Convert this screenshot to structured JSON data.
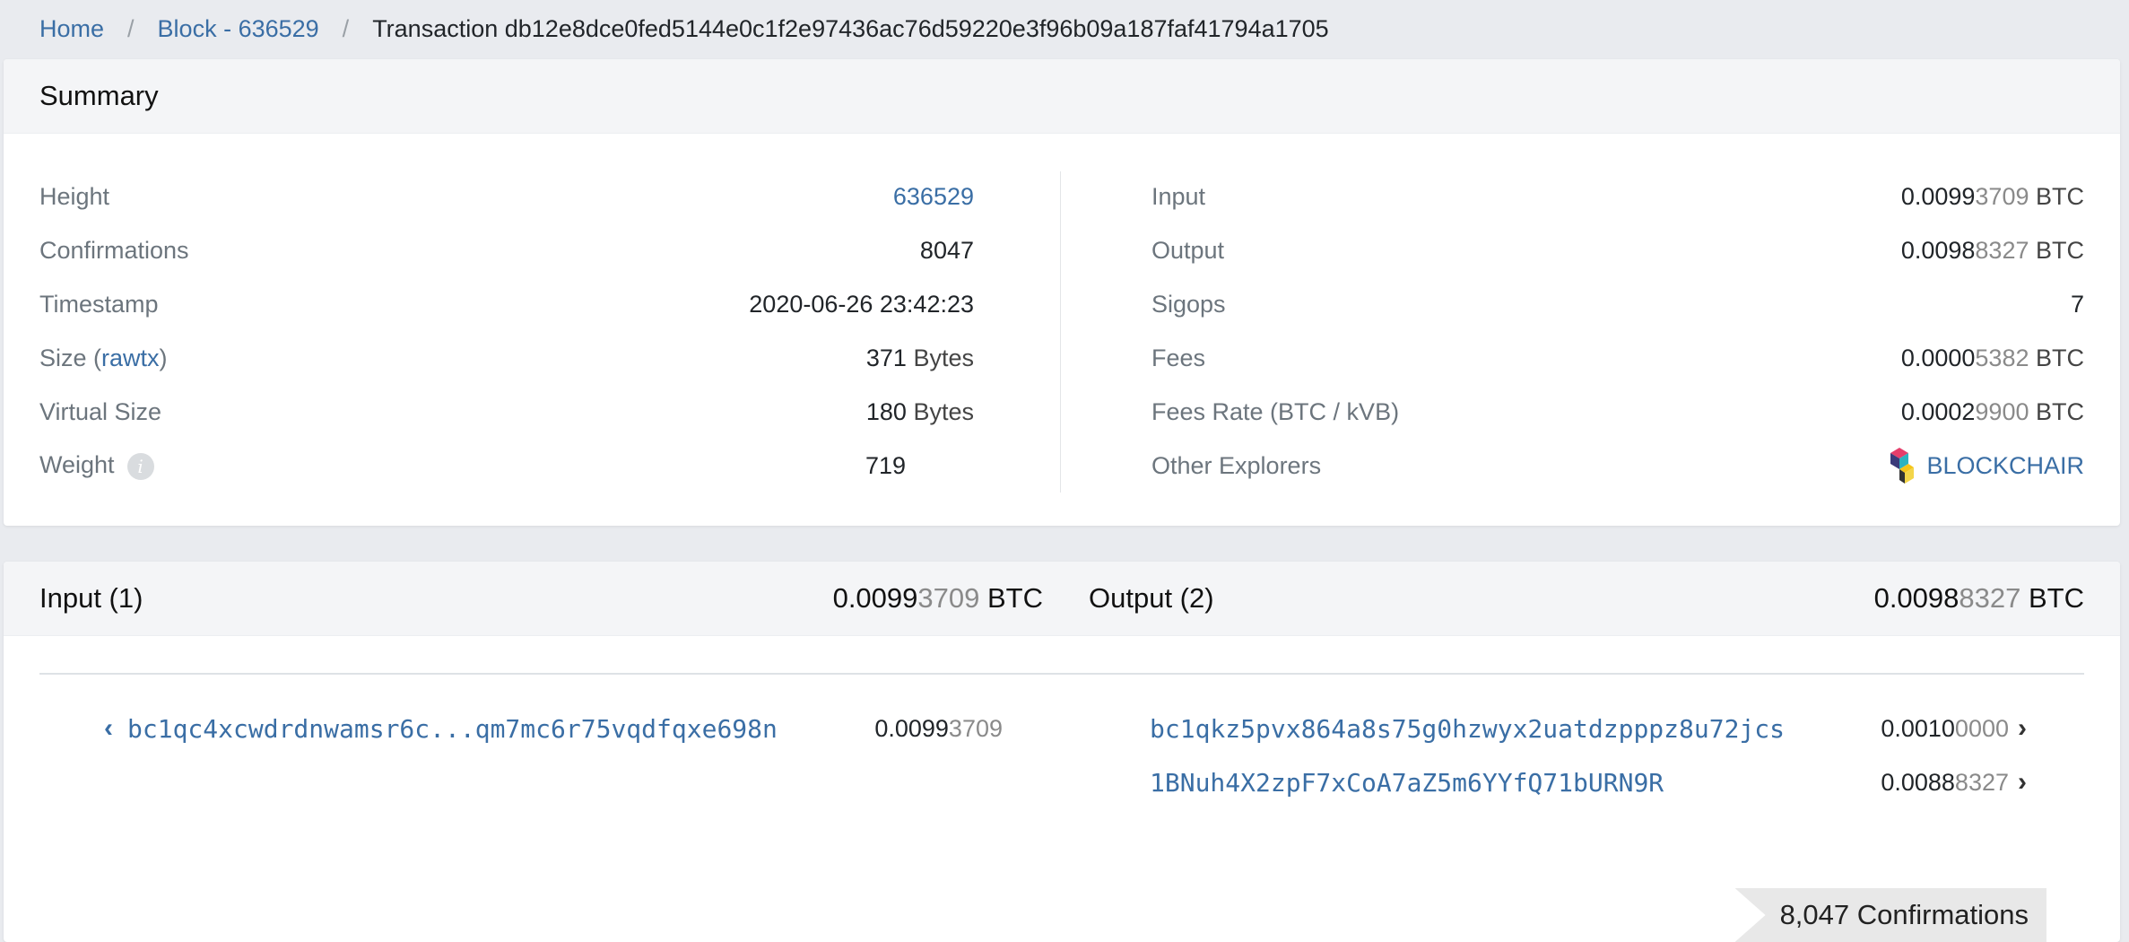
{
  "breadcrumb": {
    "home": "Home",
    "block": "Block - 636529",
    "current": "Transaction db12e8dce0fed5144e0c1f2e97436ac76d59220e3f96b09a187faf41794a1705"
  },
  "summary": {
    "title": "Summary",
    "left": {
      "height_label": "Height",
      "height_value": "636529",
      "confirmations_label": "Confirmations",
      "confirmations_value": "8047",
      "timestamp_label": "Timestamp",
      "timestamp_value": "2020-06-26 23:42:23",
      "size_label_prefix": "Size (",
      "size_label_link": "rawtx",
      "size_label_suffix": ")",
      "size_value": "371",
      "size_unit": "Bytes",
      "vsize_label": "Virtual Size",
      "vsize_value": "180",
      "vsize_unit": "Bytes",
      "weight_label": "Weight",
      "weight_info_glyph": "i",
      "weight_value": "719"
    },
    "right": {
      "input_label": "Input",
      "input_value_main": "0.0099",
      "input_value_dim": "3709",
      "output_label": "Output",
      "output_value_main": "0.0098",
      "output_value_dim": "8327",
      "sigops_label": "Sigops",
      "sigops_value": "7",
      "fees_label": "Fees",
      "fees_value_main": "0.0000",
      "fees_value_dim": "5382",
      "feerate_label": "Fees Rate (BTC / kVB)",
      "feerate_value_main": "0.0002",
      "feerate_value_dim": "9900",
      "unit": "BTC",
      "explorers_label": "Other Explorers",
      "explorer_name": "BLOCKCHAIR"
    }
  },
  "io": {
    "input_title": "Input (1)",
    "input_total_main": "0.0099",
    "input_total_dim": "3709",
    "output_title": "Output (2)",
    "output_total_main": "0.0098",
    "output_total_dim": "8327",
    "unit": "BTC",
    "inputs": [
      {
        "address": "bc1qc4xcwdrdnwamsr6c...qm7mc6r75vqdfqxe698n",
        "amount_main": "0.0099",
        "amount_dim": "3709"
      }
    ],
    "outputs": [
      {
        "address": "bc1qkz5pvx864a8s75g0hzwyx2uatdzpppz8u72jcs",
        "amount_main": "0.0010",
        "amount_dim": "0000"
      },
      {
        "address": "1BNuh4X2zpF7xCoA7aZ5m6YYfQ71bURN9R",
        "amount_main": "0.0088",
        "amount_dim": "8327"
      }
    ],
    "confirmations_badge": "8,047 Confirmations"
  },
  "icons": {
    "input_chevron": "chevron-left-icon",
    "output_chevron": "chevron-right-icon",
    "info": "info-icon",
    "blockchair": "blockchair-logo-icon"
  }
}
